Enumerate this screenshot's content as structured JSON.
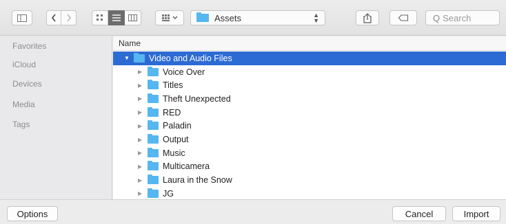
{
  "toolbar": {
    "path_popup": {
      "label": "Assets"
    },
    "search": {
      "placeholder": "Search",
      "icon_glyph": "Q"
    }
  },
  "sidebar": {
    "items": [
      {
        "label": "Favorites"
      },
      {
        "label": "iCloud"
      },
      {
        "label": "Devices"
      },
      {
        "label": "Media"
      },
      {
        "label": "Tags"
      }
    ]
  },
  "file_list": {
    "column_header": "Name",
    "rows": [
      {
        "label": "Video and Audio Files",
        "expanded": true,
        "selected": true,
        "level": 0
      },
      {
        "label": "Voice Over",
        "level": 1
      },
      {
        "label": "Titles",
        "level": 1
      },
      {
        "label": "Theft Unexpected",
        "level": 1
      },
      {
        "label": "RED",
        "level": 1
      },
      {
        "label": "Paladin",
        "level": 1
      },
      {
        "label": "Output",
        "level": 1
      },
      {
        "label": "Music",
        "level": 1
      },
      {
        "label": "Multicamera",
        "level": 1
      },
      {
        "label": "Laura in the Snow",
        "level": 1
      },
      {
        "label": "JG",
        "level": 1
      }
    ]
  },
  "footer": {
    "options_label": "Options",
    "cancel_label": "Cancel",
    "import_label": "Import"
  },
  "colors": {
    "selection": "#2d6bd4",
    "folder": "#56b6ef"
  }
}
